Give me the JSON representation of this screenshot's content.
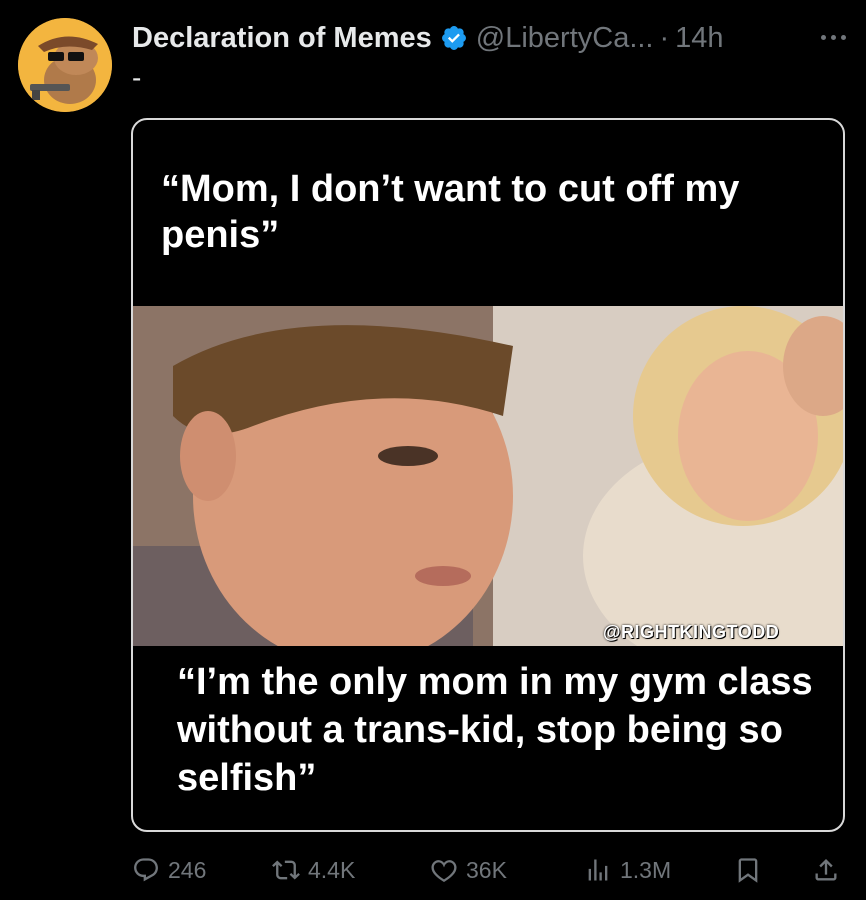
{
  "post": {
    "author_name": "Declaration of Memes",
    "handle": "@LibertyCa...",
    "separator": "·",
    "time": "14h",
    "text": "-"
  },
  "media": {
    "caption_top": "“Mom, I don’t want to cut off my penis”",
    "caption_bottom": "“I’m the only mom in my gym class without a trans-kid, stop being so selfish”",
    "watermark": "@RIGHTKINGTODD"
  },
  "actions": {
    "replies": "246",
    "reposts": "4.4K",
    "likes": "36K",
    "views": "1.3M"
  },
  "colors": {
    "background": "#000000",
    "primary_text": "#e7e9ea",
    "secondary_text": "#71767b",
    "verified_badge": "#1d9bf0",
    "avatar_bg": "#f3b53f"
  },
  "icons": [
    "verified-badge-icon",
    "more-icon",
    "reply-icon",
    "repost-icon",
    "like-icon",
    "views-icon",
    "bookmark-icon",
    "share-icon"
  ]
}
